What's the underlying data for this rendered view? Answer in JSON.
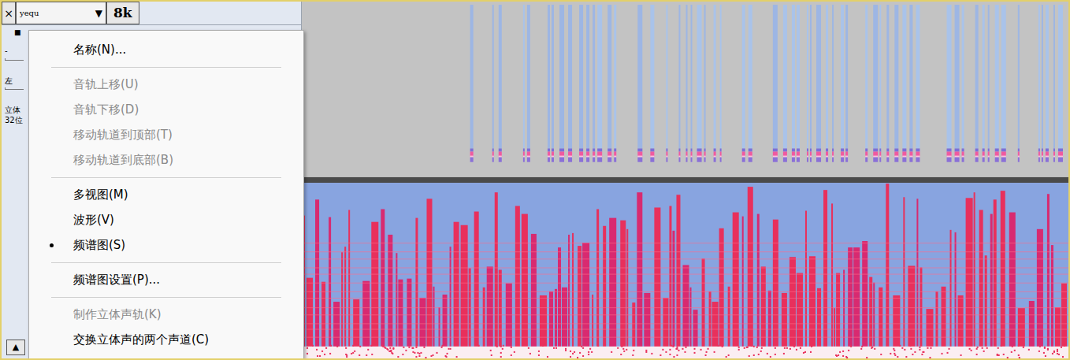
{
  "track": {
    "close": "×",
    "name": "yequ",
    "dropdown": "▼",
    "rate": "8k",
    "selected": true,
    "controls": {
      "mute": "■",
      "gain": "-",
      "pan": "左",
      "format": [
        "立体",
        "32位"
      ],
      "collapse": "▲"
    }
  },
  "context_menu": {
    "items": [
      {
        "kind": "item",
        "label": "名称(N)...",
        "disabled": false,
        "checked": false
      },
      {
        "kind": "separator"
      },
      {
        "kind": "item",
        "label": "音轨上移(U)",
        "disabled": true,
        "checked": false
      },
      {
        "kind": "item",
        "label": "音轨下移(D)",
        "disabled": true,
        "checked": false
      },
      {
        "kind": "item",
        "label": "移动轨道到顶部(T)",
        "disabled": true,
        "checked": false
      },
      {
        "kind": "item",
        "label": "移动轨道到底部(B)",
        "disabled": true,
        "checked": false
      },
      {
        "kind": "separator"
      },
      {
        "kind": "item",
        "label": "多视图(M)",
        "disabled": false,
        "checked": false
      },
      {
        "kind": "item",
        "label": "波形(V)",
        "disabled": false,
        "checked": false
      },
      {
        "kind": "item",
        "label": "频谱图(S)",
        "disabled": false,
        "checked": true
      },
      {
        "kind": "separator"
      },
      {
        "kind": "item",
        "label": "频谱图设置(P)...",
        "disabled": false,
        "checked": false
      },
      {
        "kind": "separator"
      },
      {
        "kind": "item",
        "label": "制作立体声轨(K)",
        "disabled": true,
        "checked": false
      },
      {
        "kind": "item",
        "label": "交换立体声的两个声道(C)",
        "disabled": false,
        "checked": false
      }
    ]
  }
}
